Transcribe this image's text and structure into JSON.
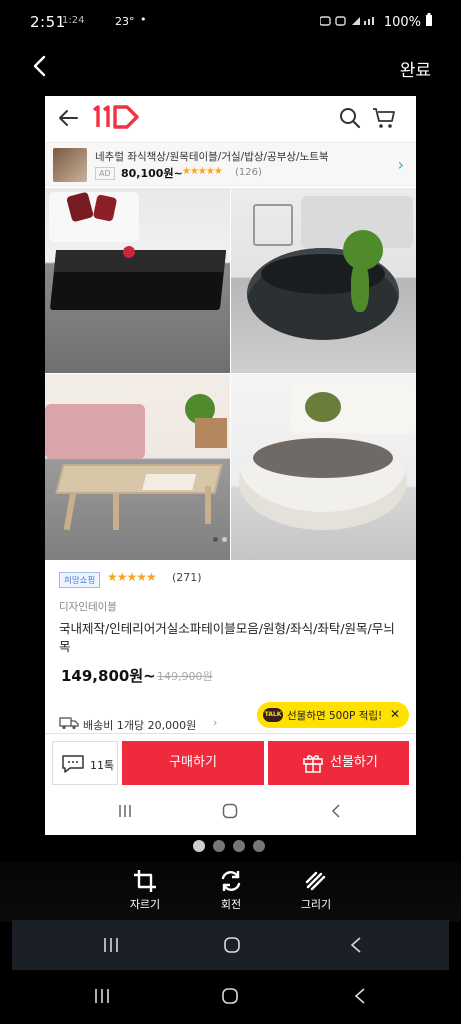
{
  "status_bar": {
    "time": "2:51",
    "ghost_text": "1:24",
    "temperature": "23°",
    "dot": "•",
    "battery": "100%"
  },
  "editor": {
    "done_label": "완료",
    "tools": [
      {
        "label": "자르기",
        "icon": "crop-icon"
      },
      {
        "label": "회전",
        "icon": "rotate-icon"
      },
      {
        "label": "그리기",
        "icon": "draw-icon"
      }
    ],
    "pager": {
      "count": 4,
      "active": 0
    }
  },
  "preview": {
    "logo": "11",
    "ad": {
      "title": "네추럴 좌식책상/원목테이블/거실/밥상/공부상/노트북",
      "badge": "AD",
      "price": "80,100원~",
      "stars": "★★★★★",
      "rating_stars": 4.5,
      "review_count": "(126)"
    },
    "gallery": {
      "image_count": 4,
      "dot_count": 4,
      "active_dot": 0
    },
    "product": {
      "tag": "희망쇼핑",
      "stars": "★★★★★",
      "rating_stars": 4.5,
      "review_count": "(271)",
      "seller": "디자인테이블",
      "title": "국내제작/인테리어거실소파테이블모음/원형/좌식/좌탁/원목/무늬목",
      "price": "149,800원~",
      "original_price": "149,900원",
      "shipping": "배송비 1개당 20,000원",
      "gift_tip": "선물하면 500P 적립!",
      "gift_tip_badge": "TALK"
    },
    "actions": {
      "talk_label": "11톡",
      "buy_label": "구매하기",
      "gift_label": "선물하기"
    }
  },
  "colors": {
    "brand": "#f43142",
    "action_red": "#ef2a3d",
    "gift_yellow": "#ffe100",
    "star": "#f5a623"
  }
}
